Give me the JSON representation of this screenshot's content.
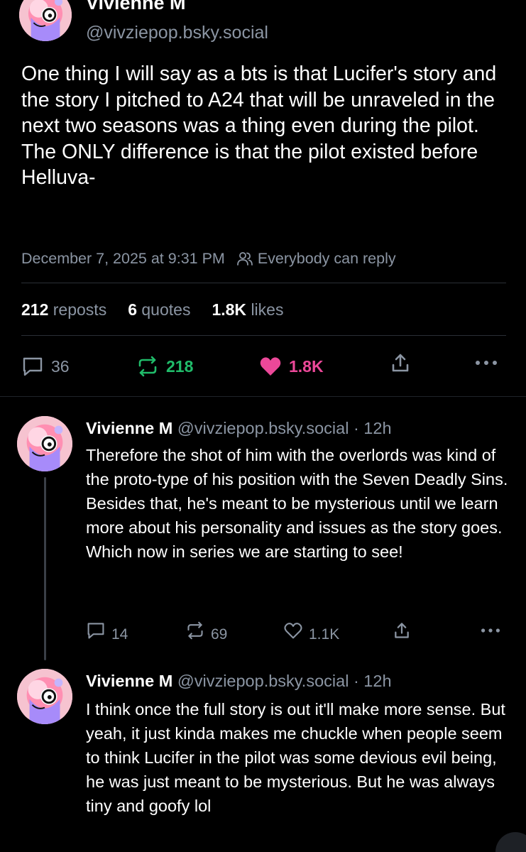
{
  "main_post": {
    "author_name": "Vivienne M",
    "author_handle": "@vivziepop.bsky.social",
    "text": "One thing I will say as a bts is that Lucifer's story and the story I pitched to A24 that will be unraveled in the next two seasons was a thing even during the pilot. The ONLY difference is that the pilot existed before Helluva-",
    "timestamp": "December 7, 2025 at 9:31 PM",
    "reply_setting": "Everybody can reply",
    "stats": {
      "reposts_count": "212",
      "reposts_label": "reposts",
      "quotes_count": "6",
      "quotes_label": "quotes",
      "likes_count": "1.8K",
      "likes_label": "likes"
    },
    "actions": {
      "replies": "36",
      "reposts": "218",
      "likes": "1.8K"
    }
  },
  "replies": [
    {
      "author_name": "Vivienne M",
      "author_handle": "@vivziepop.bsky.social",
      "age": "· 12h",
      "text": "Therefore the shot of him with the overlords was kind of the proto-type of his position with the Seven Deadly Sins. Besides that, he's meant to be mysterious until we learn more about his personality and issues as the story goes. Which now in series we are starting to see!",
      "replies": "14",
      "reposts": "69",
      "likes": "1.1K"
    },
    {
      "author_name": "Vivienne M",
      "author_handle": "@vivziepop.bsky.social",
      "age": "· 12h",
      "text": "I think once the full story is out it'll make more sense. But yeah, it just kinda makes me chuckle when people seem to think Lucifer in the pilot was some devious evil being, he was just meant to be mysterious. But he was always tiny and goofy lol"
    }
  ],
  "icons": {
    "reply": "speech-bubble-icon",
    "repost": "repost-arrows-icon",
    "like": "heart-icon",
    "share": "share-upload-icon",
    "more": "ellipsis-icon",
    "reply_setting": "people-icon"
  },
  "colors": {
    "background": "#000000",
    "muted_text": "#8b95a3",
    "repost_active": "#20bc6a",
    "like_active": "#ec4899",
    "divider": "#2b2f36"
  }
}
